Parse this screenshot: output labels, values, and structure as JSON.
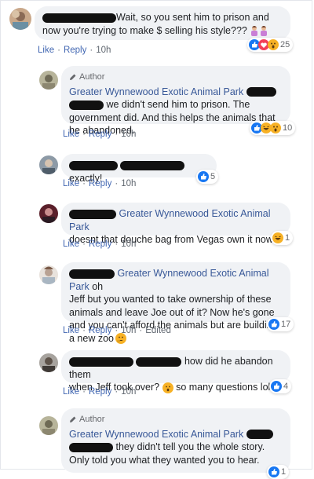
{
  "comments": [
    {
      "text": "Wait, so you sent him to prison and now you're trying to make $ selling his style???",
      "actions": {
        "like": "Like",
        "reply": "Reply",
        "time": "10h"
      },
      "reaction_count": "25"
    },
    {
      "author_badge": "Author",
      "name": "Greater Wynnewood Exotic Animal Park",
      "text": "we didn't send him to prison. The government did. And this helps the animals that he abandoned.",
      "actions": {
        "like": "Like",
        "reply": "Reply",
        "time": "10h"
      },
      "reaction_count": "10"
    },
    {
      "text": "exactly!",
      "actions": {
        "like": "Like",
        "reply": "Reply",
        "time": "10h"
      },
      "reaction_count": "5"
    },
    {
      "name": "Greater Wynnewood Exotic Animal Park",
      "text": "doesnt that douche bag from Vegas own it now?",
      "actions": {
        "like": "Like",
        "reply": "Reply",
        "time": "10h"
      },
      "reaction_count": "1"
    },
    {
      "name": "Greater Wynnewood Exotic Animal Park",
      "name_suffix": "oh",
      "text": "Jeff but you wanted to take ownership of these animals and leave Joe out of it? Now he's gone and you can't afford the animals but are building a new zoo",
      "actions": {
        "like": "Like",
        "reply": "Reply",
        "time": "10h",
        "edited": "Edited"
      },
      "reaction_count": "17"
    },
    {
      "text_inline": "how did he abandon them",
      "text": "when Jeff took over?",
      "text_tail": "so many questions lol",
      "actions": {
        "like": "Like",
        "reply": "Reply",
        "time": "10h"
      },
      "reaction_count": "4"
    },
    {
      "author_badge": "Author",
      "name": "Greater Wynnewood Exotic Animal Park",
      "text": "they didn't tell you the whole story. Only told you what they wanted you to hear.",
      "reaction_count": "1"
    }
  ],
  "separator": "·",
  "colors": {
    "link": "#385898",
    "bubble": "#f0f2f5",
    "like_blue": "#1877f2",
    "love_red": "#f33e58",
    "wow_yellow": "#f7b125"
  }
}
